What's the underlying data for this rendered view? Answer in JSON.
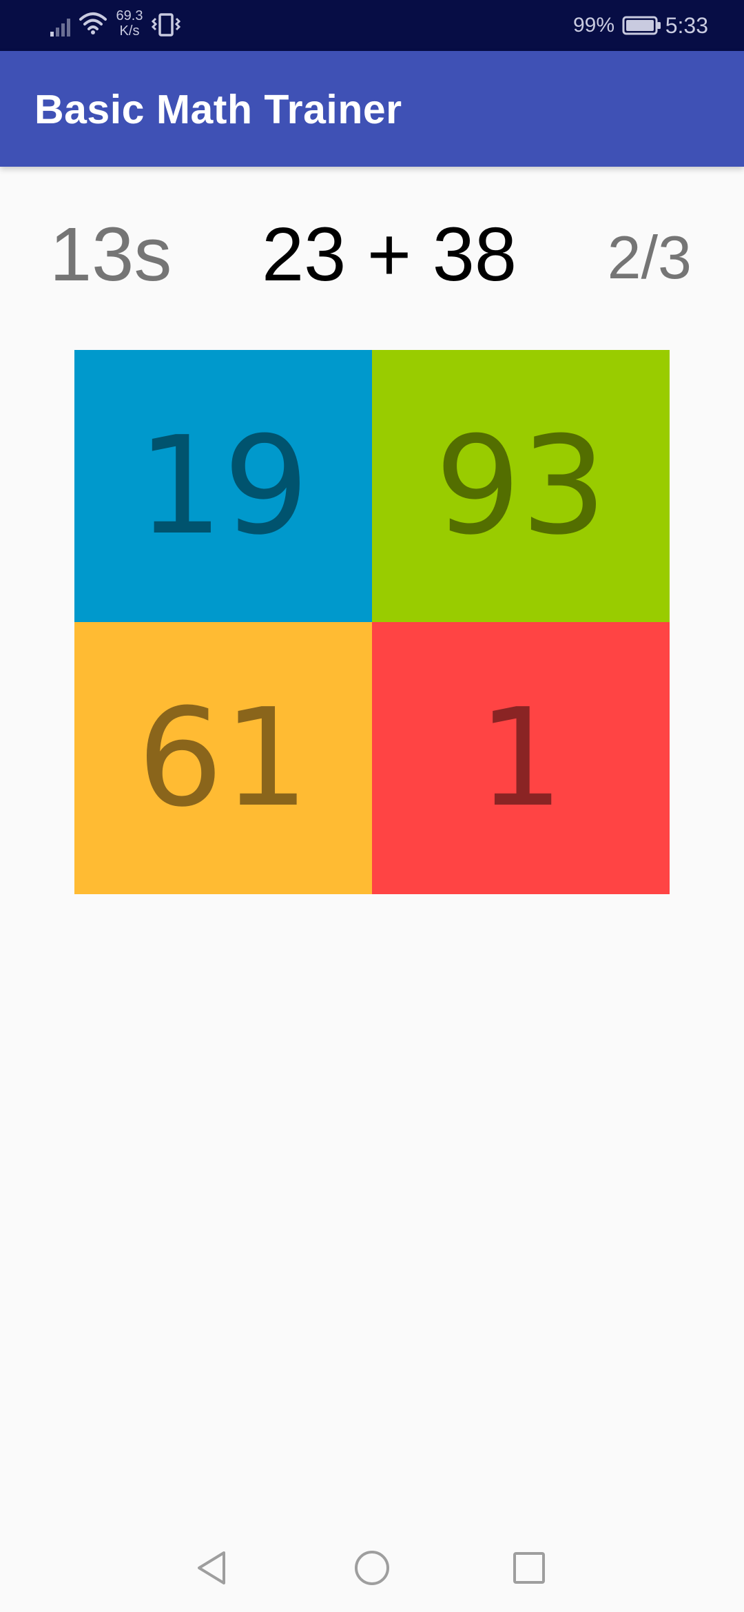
{
  "status_bar": {
    "net_speed_value": "69.3",
    "net_speed_unit": "K/s",
    "battery_percent": "99%",
    "time": "5:33",
    "icons": [
      "signal-icon",
      "wifi-icon",
      "vibrate-icon",
      "battery-icon"
    ]
  },
  "app_bar": {
    "title": "Basic Math Trainer",
    "color": "#3f51b5"
  },
  "quiz": {
    "timer": "13s",
    "problem": "23 + 38",
    "progress": "2/3"
  },
  "answers": [
    {
      "label": "19",
      "color": "#0099cc"
    },
    {
      "label": "93",
      "color": "#99cc00"
    },
    {
      "label": "61",
      "color": "#ffbb33"
    },
    {
      "label": "1",
      "color": "#ff4444"
    }
  ],
  "nav_bar": {
    "icons": [
      "back-icon",
      "home-icon",
      "recents-icon"
    ]
  }
}
